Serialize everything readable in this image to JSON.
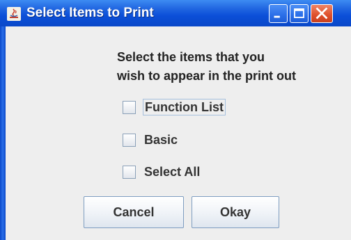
{
  "window": {
    "title": "Select Items to Print"
  },
  "prompt": {
    "line1": "Select the items that you",
    "line2": "wish to appear in the print out"
  },
  "checkboxes": [
    {
      "label": "Function List",
      "checked": false
    },
    {
      "label": "Basic",
      "checked": false
    },
    {
      "label": "Select All",
      "checked": false
    }
  ],
  "buttons": {
    "cancel": "Cancel",
    "okay": "Okay"
  },
  "colors": {
    "titlebar": "#0a48c9",
    "close": "#de4f2a",
    "client_bg": "#eeeeee"
  },
  "icons": {
    "app": "java-app-icon",
    "minimize": "minimize-icon",
    "maximize": "maximize-icon",
    "close": "close-icon"
  }
}
